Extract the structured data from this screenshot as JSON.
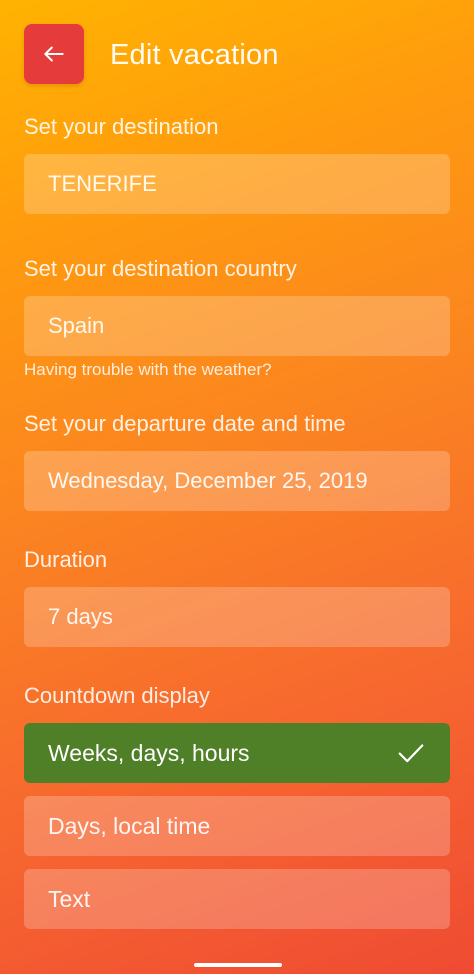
{
  "header": {
    "title": "Edit vacation",
    "back_icon": "arrow-left-icon",
    "back_color": "#e63b3b"
  },
  "destination": {
    "label": "Set your destination",
    "value": "TENERIFE"
  },
  "country": {
    "label": "Set your destination country",
    "value": "Spain",
    "hint": "Having trouble with the weather?"
  },
  "departure": {
    "label": "Set your departure date and time",
    "value": "Wednesday, December 25, 2019"
  },
  "duration": {
    "label": "Duration",
    "value": "7 days"
  },
  "countdown": {
    "label": "Countdown display",
    "selected_color": "#4f7f26",
    "options": [
      {
        "label": "Weeks, days, hours",
        "selected": true,
        "icon": "checkmark-icon"
      },
      {
        "label": "Days, local time",
        "selected": false
      },
      {
        "label": "Text",
        "selected": false
      }
    ]
  }
}
